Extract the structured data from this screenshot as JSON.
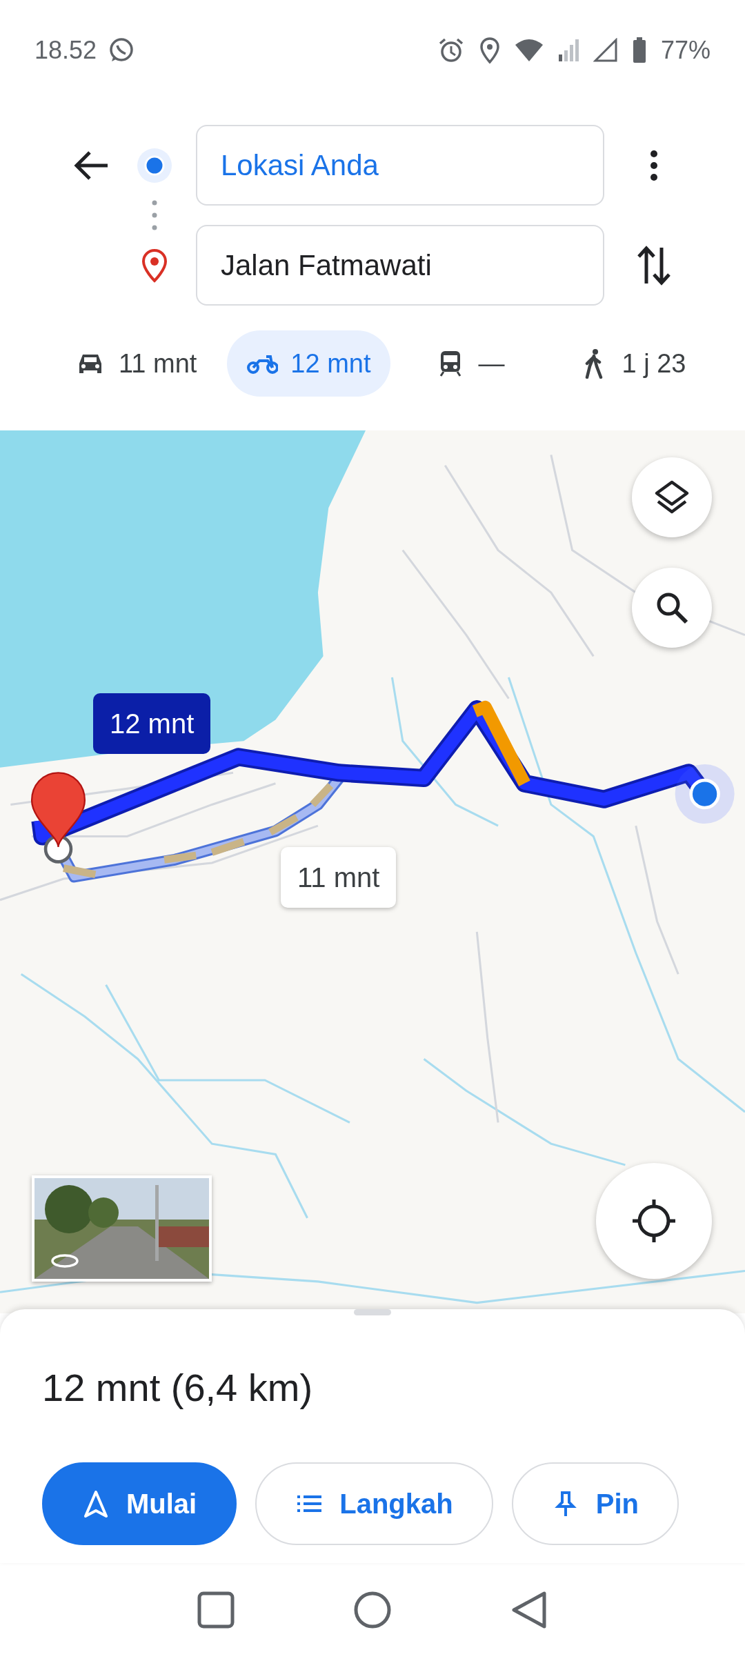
{
  "status_bar": {
    "time": "18.52",
    "battery": "77%"
  },
  "directions": {
    "origin": "Lokasi Anda",
    "destination": "Jalan Fatmawati"
  },
  "modes": [
    {
      "kind": "car",
      "label": "11 mnt",
      "selected": false
    },
    {
      "kind": "motorcycle",
      "label": "12 mnt",
      "selected": true
    },
    {
      "kind": "transit",
      "label": "—",
      "selected": false
    },
    {
      "kind": "walk",
      "label": "1 j 23",
      "selected": false
    }
  ],
  "map": {
    "kind": "picture",
    "route_labels": [
      {
        "label": "12 mnt",
        "selected": true
      },
      {
        "label": "11 mnt",
        "selected": false
      }
    ]
  },
  "summary": "12 mnt (6,4 km)",
  "actions": [
    {
      "kind": "start",
      "label": "Mulai"
    },
    {
      "kind": "steps",
      "label": "Langkah"
    },
    {
      "kind": "pin",
      "label": "Pin"
    }
  ]
}
